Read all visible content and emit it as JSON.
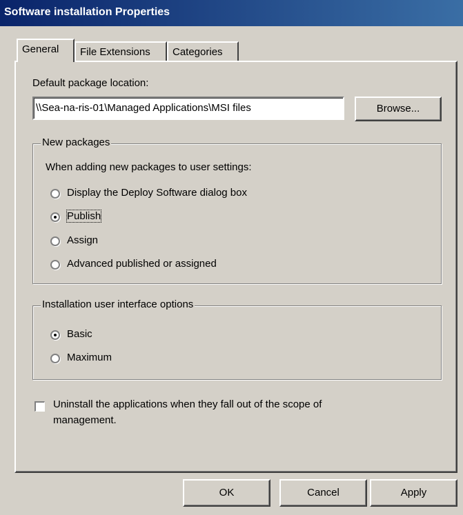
{
  "window": {
    "title": "Software installation Properties"
  },
  "tabs": [
    {
      "label": "General",
      "active": true
    },
    {
      "label": "File Extensions",
      "active": false
    },
    {
      "label": "Categories",
      "active": false
    }
  ],
  "general": {
    "default_location_label": "Default package location:",
    "default_location_value": "\\\\Sea-na-ris-01\\Managed Applications\\MSI files",
    "browse_label": "Browse...",
    "new_packages": {
      "legend": "New packages",
      "instruction": "When adding new packages to user settings:",
      "options": [
        {
          "label": "Display the Deploy Software dialog box",
          "selected": false
        },
        {
          "label": "Publish",
          "selected": true
        },
        {
          "label": "Assign",
          "selected": false
        },
        {
          "label": "Advanced published or assigned",
          "selected": false
        }
      ]
    },
    "ui_options": {
      "legend": "Installation user interface options",
      "options": [
        {
          "label": "Basic",
          "selected": true
        },
        {
          "label": "Maximum",
          "selected": false
        }
      ]
    },
    "uninstall_checkbox": {
      "label_line1": "Uninstall the applications when they fall out of the scope of",
      "label_line2": "management.",
      "checked": false
    }
  },
  "footer": {
    "ok_label": "OK",
    "cancel_label": "Cancel",
    "apply_label": "Apply"
  }
}
